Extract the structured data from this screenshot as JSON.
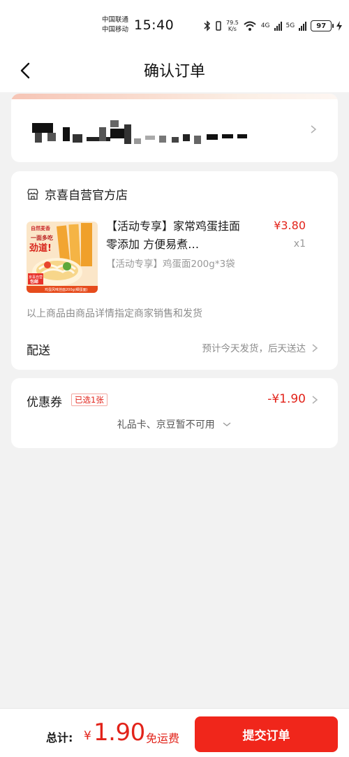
{
  "status_bar": {
    "carrier_1": "中国联通",
    "carrier_2": "中国移动",
    "time": "15:40",
    "net_speed_value": "79.5",
    "net_speed_unit": "K/s",
    "signal_1": "4G",
    "signal_2": "5G",
    "battery": "97"
  },
  "nav": {
    "title": "确认订单",
    "back_icon": "chevron-left-icon"
  },
  "shop": {
    "name": "京喜自营官方店",
    "icon": "store-icon",
    "product": {
      "title": "【活动专享】家常鸡蛋挂面零添加 方便易煮…",
      "spec": "【活动专享】鸡蛋面200g*3袋",
      "price": "¥3.80",
      "quantity": "x1",
      "image_texts": {
        "tag": "自然麦香",
        "slogan_1": "一面多吃",
        "slogan_2": "劲道!",
        "badge_1": "京喜自营",
        "badge_2": "包邮",
        "caption": "鸡蛋风味挂面200g(细蛋面)"
      }
    },
    "seller_note": "以上商品由商品详情指定商家销售和发货",
    "delivery_label": "配送",
    "delivery_value": "预计今天发货，后天送达"
  },
  "coupon": {
    "label": "优惠券",
    "badge": "已选1张",
    "amount": "-¥1.90",
    "giftcard_note": "礼品卡、京豆暂不可用"
  },
  "bottom": {
    "total_label": "总计:",
    "currency": "¥",
    "total_amount": "1.90",
    "free_shipping": "免运费",
    "submit_label": "提交订单"
  },
  "colors": {
    "accent_red": "#e2231a",
    "button_red": "#f0261b",
    "background": "#f2f2f2"
  }
}
